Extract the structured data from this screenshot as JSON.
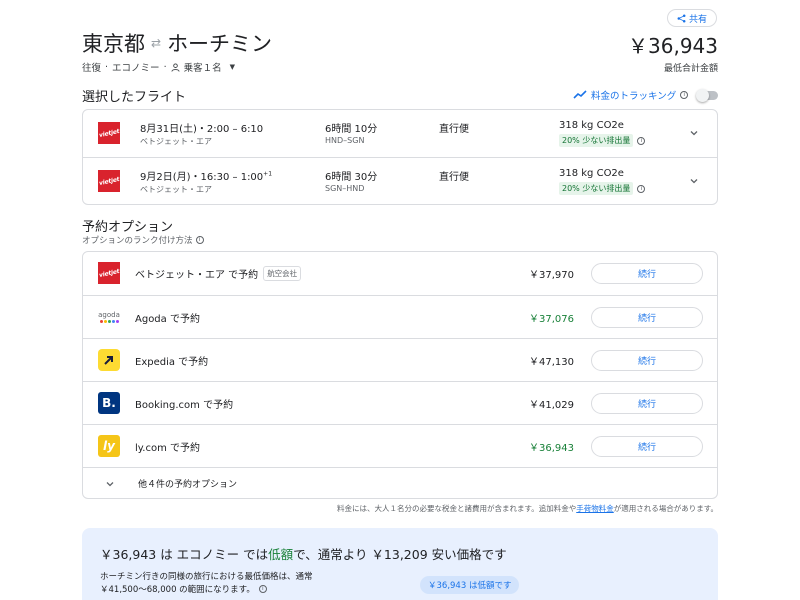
{
  "header": {
    "share_label": "共有",
    "origin": "東京都",
    "destination": "ホーチミン",
    "trip_type": "往復",
    "cabin": "エコノミー",
    "passengers": "乗客１名",
    "total_price": "￥36,943",
    "total_label": "最低合計金額"
  },
  "selected": {
    "title": "選択したフライト",
    "tracking_label": "料金のトラッキング",
    "flights": [
      {
        "datetime": "8月31日(土)・2:00 – 6:10",
        "next_day": "",
        "airline": "ベトジェット・エア",
        "duration": "6時間 10分",
        "route": "HND–SGN",
        "stops": "直行便",
        "co2": "318 kg CO2e",
        "emissions": "20% 少ない排出量"
      },
      {
        "datetime": "9月2日(月)・16:30 – 1:00",
        "next_day": "+1",
        "airline": "ベトジェット・エア",
        "duration": "6時間 30分",
        "route": "SGN–HND",
        "stops": "直行便",
        "co2": "318 kg CO2e",
        "emissions": "20% 少ない排出量"
      }
    ]
  },
  "booking": {
    "title": "予約オプション",
    "subtitle": "オプションのランク付け方法",
    "continue_label": "続行",
    "options": [
      {
        "name": "ベトジェット・エア で予約",
        "tag": "航空会社",
        "price": "￥37,970",
        "green": false
      },
      {
        "name": "Agoda で予約",
        "tag": "",
        "price": "￥37,076",
        "green": true
      },
      {
        "name": "Expedia で予約",
        "tag": "",
        "price": "￥47,130",
        "green": false
      },
      {
        "name": "Booking.com で予約",
        "tag": "",
        "price": "￥41,029",
        "green": false
      },
      {
        "name": "ly.com で予約",
        "tag": "",
        "price": "￥36,943",
        "green": true
      }
    ],
    "more_label": "他４件の予約オプション"
  },
  "fee_note": {
    "before": "料金には、大人１名分の必要な税金と諸費用が含まれます。追加料金や",
    "link": "手荷物料金",
    "after": "が適用される場合があります。"
  },
  "insight": {
    "head_before": "￥36,943 は エコノミー では",
    "head_highlight": "低額",
    "head_after": "で、通常より ￥13,209 安い価格です",
    "desc1": "ホーチミン行きの同様の旅行における最低価格は、通常",
    "desc2": "￥41,500～68,000 の範囲になります。",
    "bubble": "￥36,943 は低額です"
  },
  "logos": {
    "vietjet": "vietjet",
    "agoda": "agoda",
    "booking": "B.",
    "ly": "ly"
  },
  "colors": {
    "accent": "#1a73e8",
    "green": "#188038",
    "vietjet": "#d9232d",
    "expedia": "#fddb32",
    "booking": "#003580",
    "ly": "#f5c518"
  }
}
